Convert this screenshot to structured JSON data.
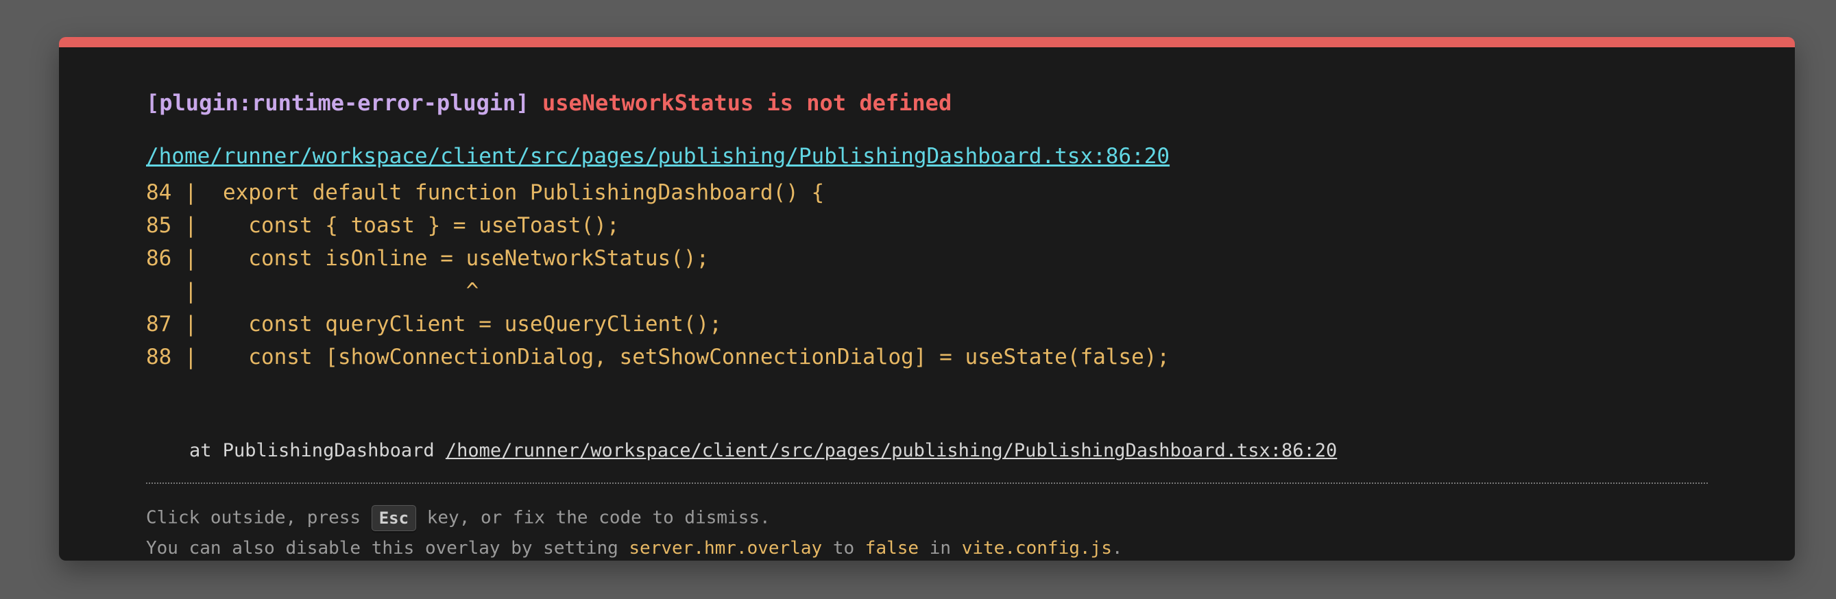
{
  "overlay": {
    "accent_color": "#e3605c",
    "plugin": "[plugin:runtime-error-plugin]",
    "message": "useNetworkStatus is not defined",
    "file": "/home/runner/workspace/client/src/pages/publishing/PublishingDashboard.tsx:86:20",
    "frame_lines": [
      "84 |  export default function PublishingDashboard() {",
      "85 |    const { toast } = useToast();",
      "86 |    const isOnline = useNetworkStatus();",
      "   |                     ^",
      "87 |    const queryClient = useQueryClient();",
      "88 |    const [showConnectionDialog, setShowConnectionDialog] = useState(false);"
    ],
    "stack": {
      "prefix": "at PublishingDashboard ",
      "link": "/home/runner/workspace/client/src/pages/publishing/PublishingDashboard.tsx:86:20"
    },
    "tip": {
      "line1_before": "Click outside, press ",
      "key": "Esc",
      "line1_after": " key, or fix the code to dismiss.",
      "line2_before": "You can also disable this overlay by setting ",
      "line2_code1": "server.hmr.overlay",
      "line2_mid1": " to ",
      "line2_code2": "false",
      "line2_mid2": " in ",
      "line2_code3": "vite.config.js",
      "line2_end": "."
    }
  }
}
